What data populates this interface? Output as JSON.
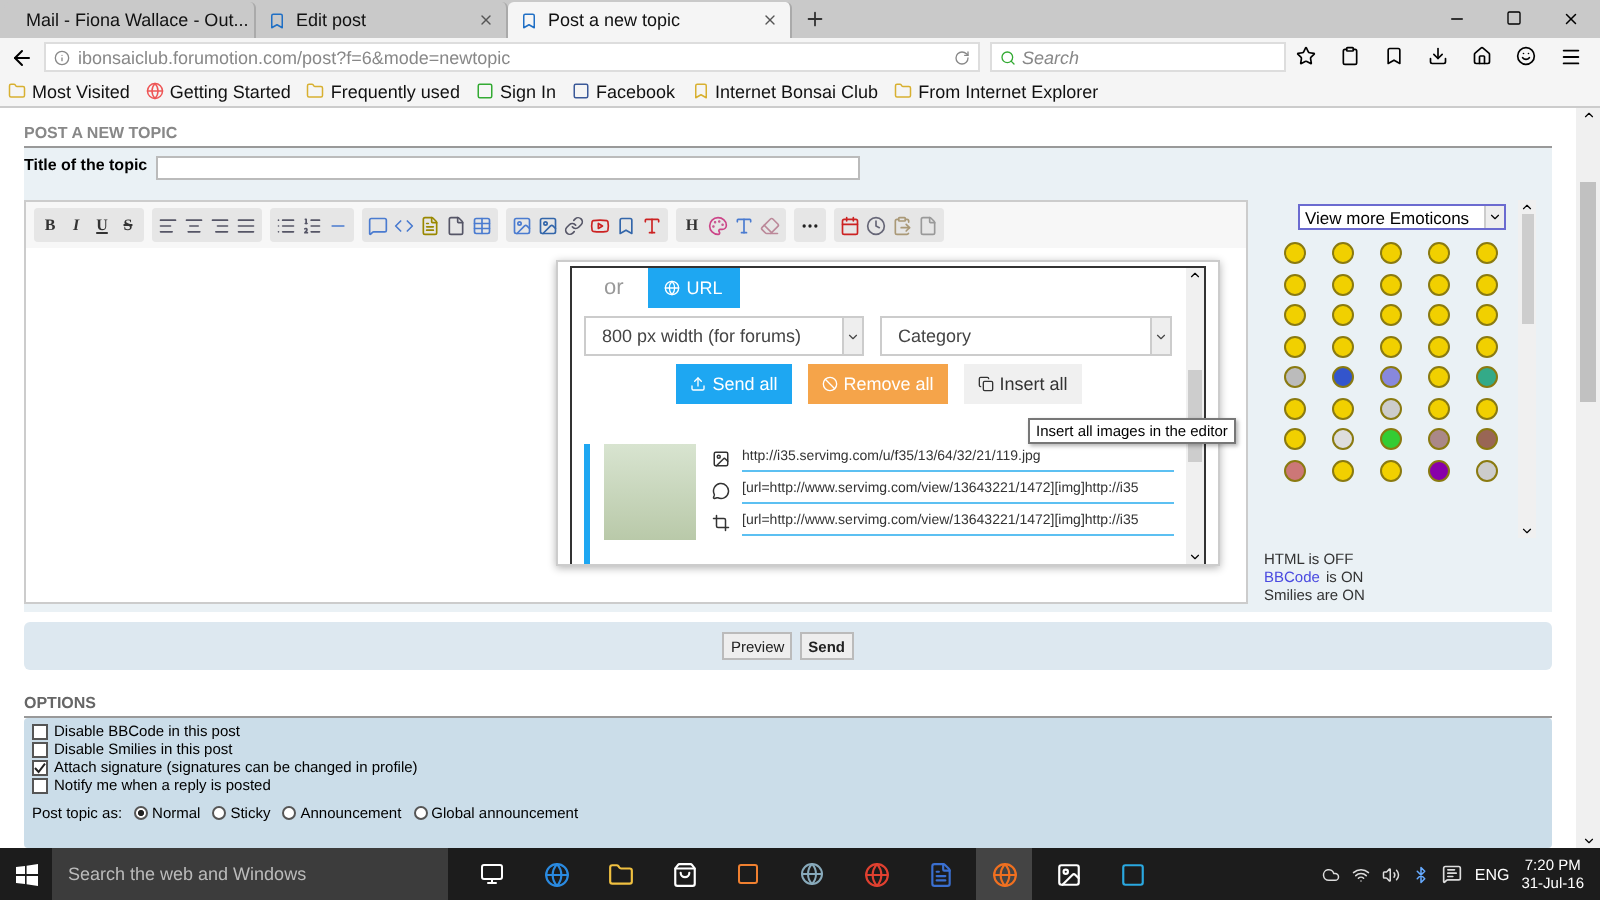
{
  "browser": {
    "tabs": [
      {
        "title": "Mail - Fiona Wallace - Out...",
        "selected": false
      },
      {
        "title": "Edit post",
        "selected": false
      },
      {
        "title": "Post a new topic",
        "selected": true
      }
    ],
    "url": "ibonsaiclub.forumotion.com/post?f=6&mode=newtopic",
    "search": {
      "placeholder": "Search"
    },
    "bookmarks": [
      "Most Visited",
      "Getting Started",
      "Frequently used",
      "Sign In",
      "Facebook",
      "Internet Bonsai Club",
      "From Internet Explorer"
    ]
  },
  "page": {
    "heading": "POST A NEW TOPIC",
    "title_label": "Title of the topic",
    "editor": {
      "format_buttons": [
        "B",
        "I",
        "U",
        "S"
      ],
      "heading_button": "H"
    },
    "emoticons": {
      "select": "View more Emoticons",
      "status": [
        {
          "text": "HTML is OFF"
        },
        {
          "link": "BBCode",
          "text": "is ON"
        },
        {
          "text": "Smilies are ON"
        }
      ]
    },
    "upload_popup": {
      "or": "or",
      "url_button": "URL",
      "size_select": "800 px width (for forums)",
      "category_select": "Category",
      "send_all": "Send all",
      "remove_all": "Remove all",
      "insert_all": "Insert all",
      "tooltip": "Insert all images in the editor",
      "links": [
        "http://i35.servimg.com/u/f35/13/64/32/21/119.jpg",
        "[url=http://www.servimg.com/view/13643221/1472][img]http://i35",
        "[url=http://www.servimg.com/view/13643221/1472][img]http://i35"
      ]
    },
    "buttons": [
      "Preview",
      "Send"
    ],
    "options_heading": "OPTIONS",
    "options": [
      {
        "label": "Disable BBCode in this post",
        "checked": false
      },
      {
        "label": "Disable Smilies in this post",
        "checked": false
      },
      {
        "label": "Attach signature (signatures can be changed in profile)",
        "checked": true
      },
      {
        "label": "Notify me when a reply is posted",
        "checked": false
      }
    ],
    "post_as": {
      "label": "Post topic as:",
      "choices": [
        {
          "label": "Normal",
          "selected": true
        },
        {
          "label": "Sticky",
          "selected": false
        },
        {
          "label": "Announcement",
          "selected": false
        },
        {
          "label": "Global announcement",
          "selected": false
        }
      ]
    }
  },
  "taskbar": {
    "search": "Search the web and Windows",
    "language": "ENG",
    "time": "7:20 PM",
    "date": "31-Jul-16"
  }
}
